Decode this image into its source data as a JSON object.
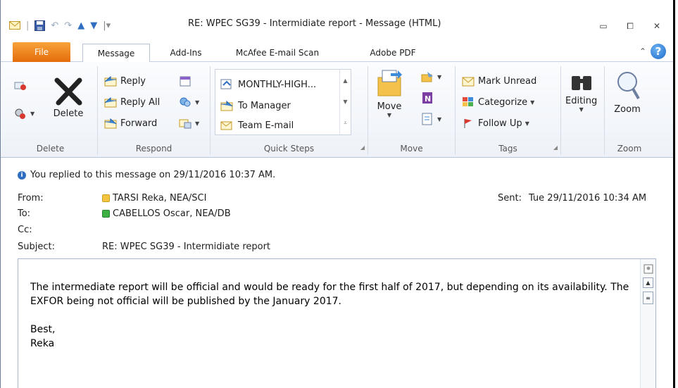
{
  "window": {
    "title": "RE: WPEC SG39 - Intermidiate report  -  Message (HTML)"
  },
  "tabs": [
    {
      "label": "File"
    },
    {
      "label": "Message"
    },
    {
      "label": "Add-Ins"
    },
    {
      "label": "McAfee E-mail Scan"
    },
    {
      "label": "Adobe PDF"
    }
  ],
  "ribbon": {
    "delete_group": {
      "label": "Delete",
      "delete_button": "Delete"
    },
    "respond_group": {
      "label": "Respond",
      "reply": "Reply",
      "reply_all": "Reply All",
      "forward": "Forward"
    },
    "quick_steps_group": {
      "label": "Quick Steps",
      "items": [
        "MONTHLY-HIGH...",
        "To Manager",
        "Team E-mail"
      ]
    },
    "move_group": {
      "label": "Move",
      "move_button": "Move"
    },
    "tags_group": {
      "label": "Tags",
      "mark_unread": "Mark Unread",
      "categorize": "Categorize",
      "follow_up": "Follow Up"
    },
    "editing_group": {
      "label": "Editing"
    },
    "zoom_group": {
      "label": "Zoom",
      "zoom_button": "Zoom"
    }
  },
  "header": {
    "info": "You replied to this message on 29/11/2016 10:37 AM.",
    "from_label": "From:",
    "from_value": "TARSI Reka, NEA/SCI",
    "to_label": "To:",
    "to_value": "CABELLOS Oscar, NEA/DB",
    "cc_label": "Cc:",
    "subject_label": "Subject:",
    "subject_value": "RE: WPEC SG39 - Intermidiate report",
    "sent_label": "Sent:",
    "sent_value": "Tue 29/11/2016 10:34 AM"
  },
  "body": {
    "paragraph": "The intermediate report will be official and would be ready for the first half of 2017, but depending on its availability. The EXFOR being not official will be published by the January 2017.",
    "closing": "Best,",
    "signature": "Reka"
  },
  "colors": {
    "file_tab": "#e46c0a",
    "from_presence": "#f5c542",
    "to_presence": "#3cb043",
    "info_icon": "#2f6ec1"
  }
}
